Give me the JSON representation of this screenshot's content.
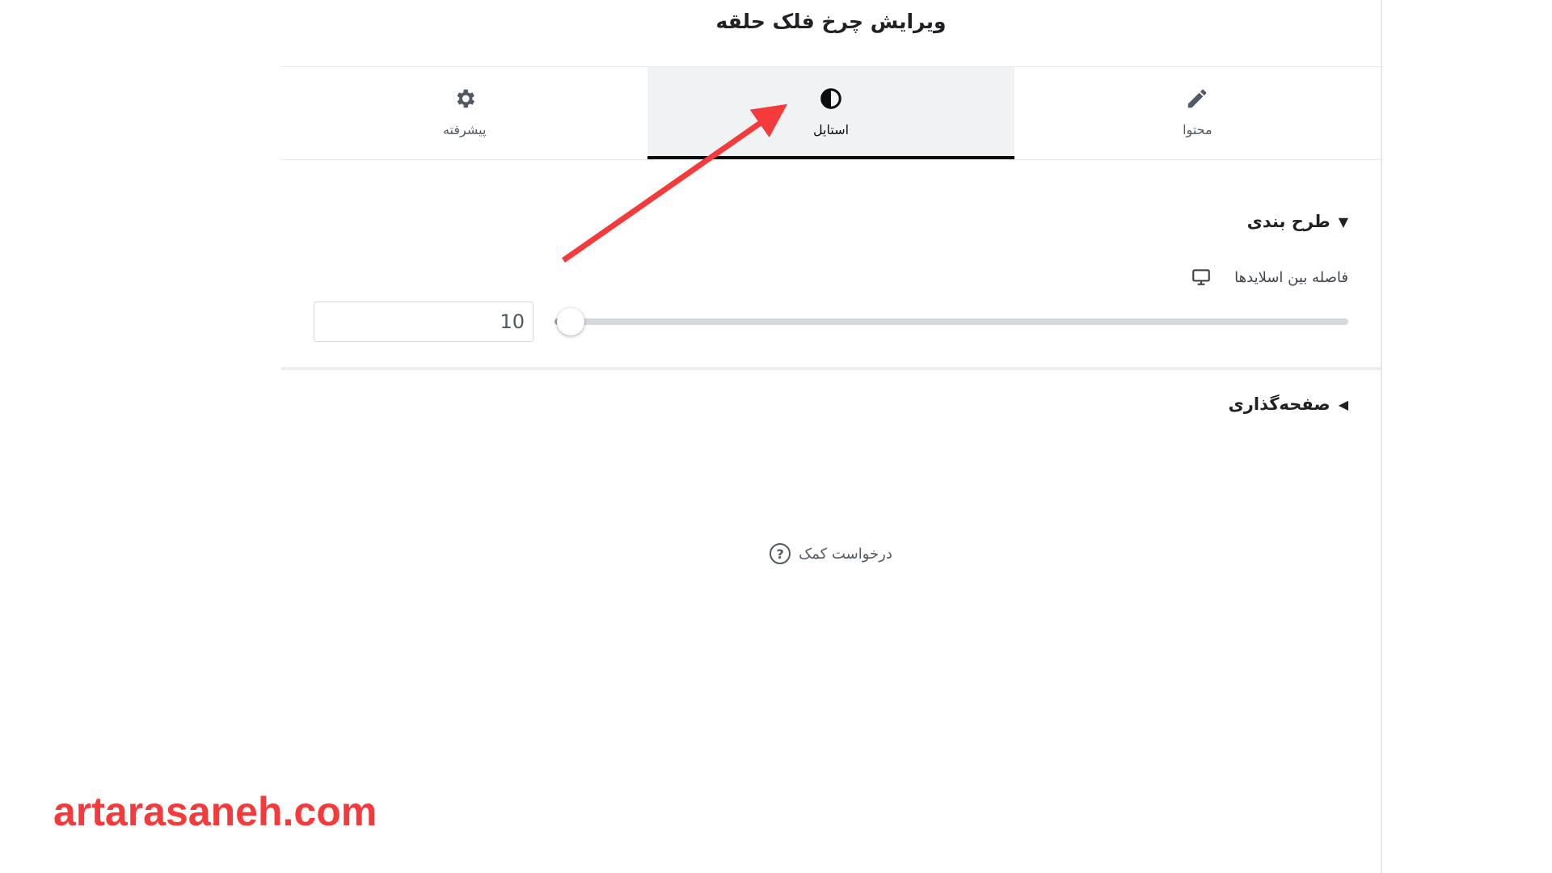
{
  "panel": {
    "title": "ویرایش چرخ فلک حلقه"
  },
  "tabs": [
    {
      "label": "محتوا",
      "icon": "pencil-icon",
      "active": false
    },
    {
      "label": "استایل",
      "icon": "contrast-icon",
      "active": true
    },
    {
      "label": "پیشرفته",
      "icon": "gear-icon",
      "active": false
    }
  ],
  "layout_section": {
    "title": "طرح بندی",
    "expanded": true,
    "slide_spacing": {
      "label": "فاصله بین اسلایدها",
      "device_icon": "desktop-icon",
      "value": "10",
      "slider_fraction": 0.0
    }
  },
  "pagination_section": {
    "title": "صفحه‌گذاری",
    "expanded": false
  },
  "help": {
    "label": "درخواست کمک",
    "icon": "question-icon"
  },
  "annotation": {
    "color": "#f43a3a",
    "icon": "red-arrow"
  },
  "watermark": {
    "text": "artarasaneh.com",
    "color": "#f43a3a"
  }
}
